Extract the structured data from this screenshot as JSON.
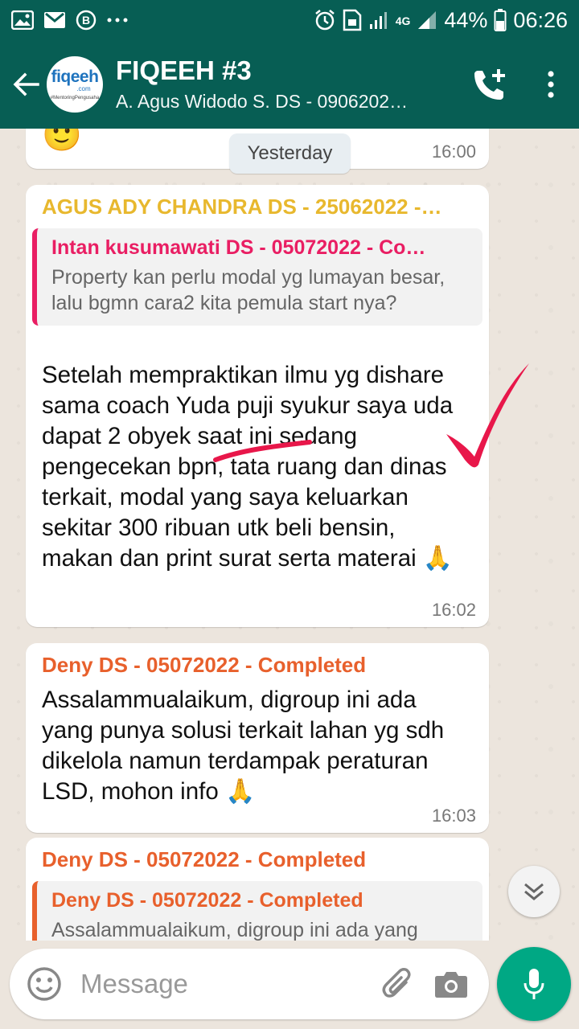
{
  "status_bar": {
    "signal_label": "4G",
    "battery": "44%",
    "time": "06:26",
    "icons_left": [
      "gallery-icon",
      "gmail-icon",
      "b-app-icon",
      "more-dots-icon"
    ],
    "icons_right": [
      "alarm-icon",
      "sim-icon",
      "signal-icon",
      "battery-icon"
    ]
  },
  "header": {
    "logo_text": "fiqeeh",
    "logo_domain": ".com",
    "logo_tagline": "#MentoringPengusaha",
    "title": "FIQEEH #3",
    "subtitle": "A. Agus Widodo S. DS - 0906202…"
  },
  "chat": {
    "date_chip": "Yesterday",
    "messages": [
      {
        "time": "16:00",
        "emoji": "🙂"
      },
      {
        "sender": "AGUS ADY CHANDRA DS - 25062022 -…",
        "sender_color": "#e8b82e",
        "quote_sender": "Intan kusumawati DS - 05072022 - Co…",
        "quote_sender_color": "#e91e63",
        "quote_text": "Property kan perlu modal yg lumayan besar, lalu bgmn cara2 kita pemula start nya?",
        "text": "Setelah mempraktikan ilmu yg dishare sama coach Yuda puji syukur saya uda dapat 2 obyek saat ini sedang pengecekan bpn, tata ruang dan dinas terkait, modal yang saya keluarkan sekitar 300 ribuan utk beli bensin, makan dan print surat serta materai",
        "emoji": "🙏",
        "time": "16:02"
      },
      {
        "sender": "Deny DS - 05072022 - Completed",
        "sender_color": "#e8602c",
        "text": "Assalammualaikum, digroup ini ada yang punya solusi terkait lahan yg sdh dikelola namun terdampak peraturan LSD, mohon info",
        "emoji": "🙏",
        "time": "16:03"
      },
      {
        "sender": "Deny DS - 05072022 - Completed",
        "sender_color": "#e8602c",
        "quote_sender": "Deny DS - 05072022 - Completed",
        "quote_sender_color": "#e8602c",
        "quote_text": "Assalammualaikum, digroup ini ada yang"
      }
    ]
  },
  "input": {
    "placeholder": "Message"
  },
  "colors": {
    "primary": "#075e54",
    "accent": "#00a884",
    "annotation": "#e8174a"
  }
}
